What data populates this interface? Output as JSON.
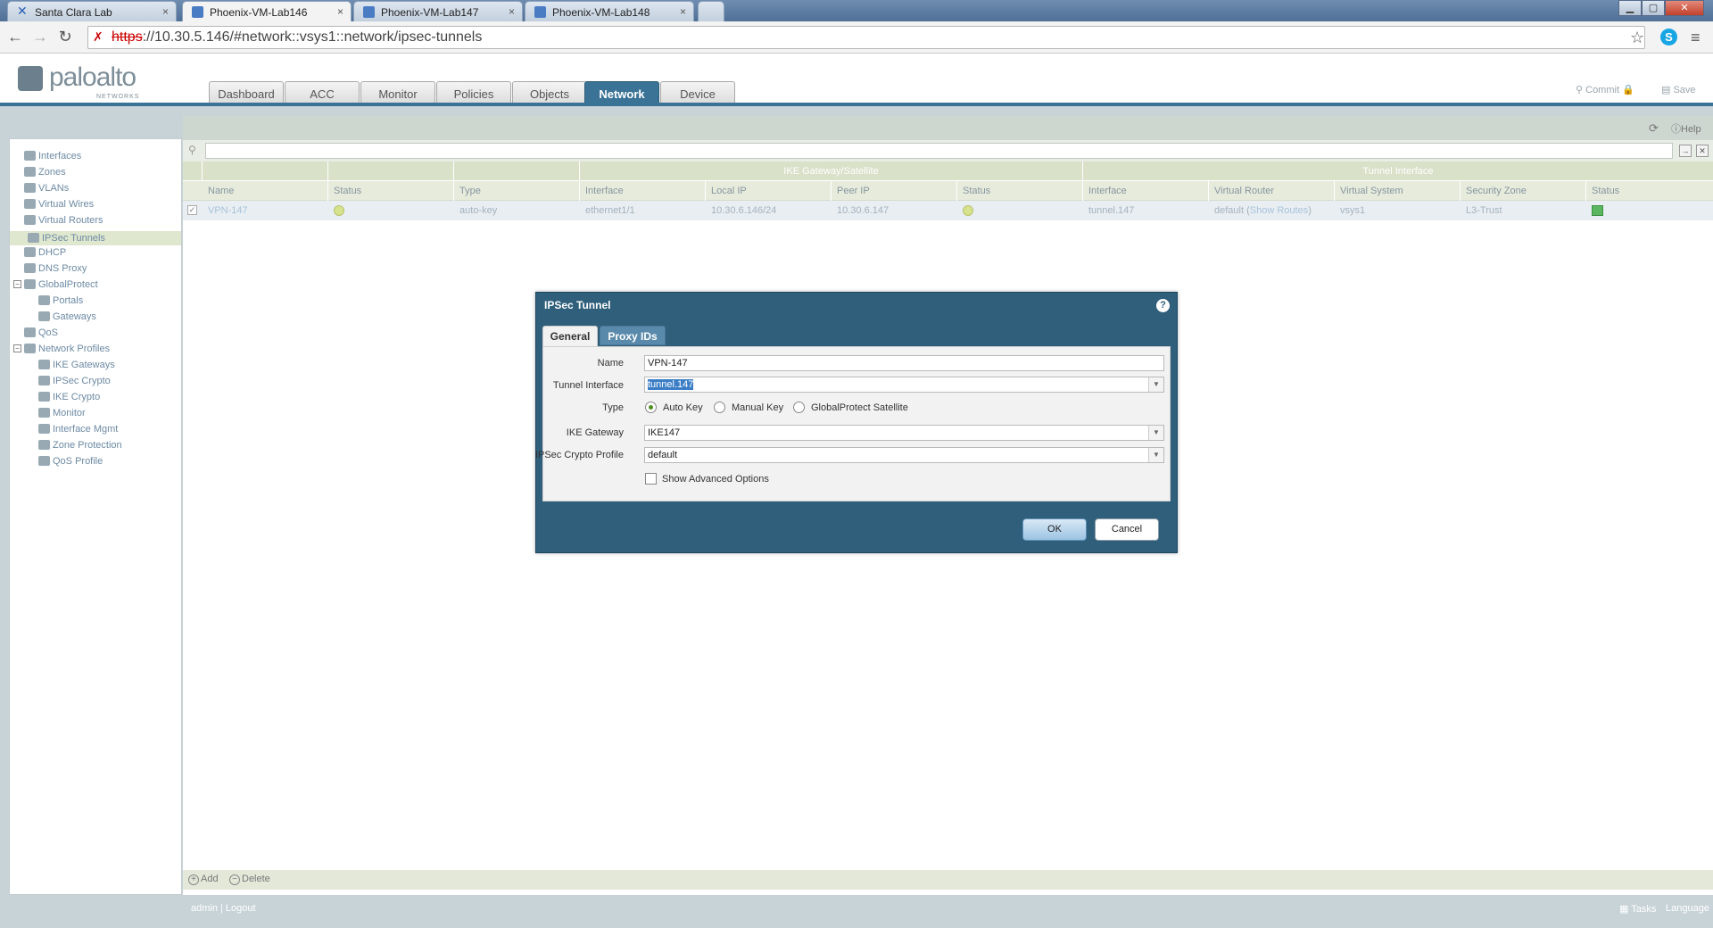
{
  "browser": {
    "tabs": [
      {
        "title": "Santa Clara Lab",
        "active": false
      },
      {
        "title": "Phoenix-VM-Lab146",
        "active": true
      },
      {
        "title": "Phoenix-VM-Lab147",
        "active": false
      },
      {
        "title": "Phoenix-VM-Lab148",
        "active": false
      }
    ],
    "close_glyph": "×",
    "url_scheme": "https",
    "url_rest": "://10.30.5.146/#network::vsys1::network/ipsec-tunnels"
  },
  "app": {
    "logo_text": "paloalto",
    "logo_sub": "NETWORKS",
    "main_tabs": [
      "Dashboard",
      "ACC",
      "Monitor",
      "Policies",
      "Objects",
      "Network",
      "Device"
    ],
    "active_tab": "Network",
    "commit_label": "Commit",
    "save_label": "Save",
    "help_label": "Help"
  },
  "sidebar": {
    "items": [
      {
        "label": "Interfaces",
        "level": 0
      },
      {
        "label": "Zones",
        "level": 0
      },
      {
        "label": "VLANs",
        "level": 0
      },
      {
        "label": "Virtual Wires",
        "level": 0
      },
      {
        "label": "Virtual Routers",
        "level": 0
      },
      {
        "label": "IPSec Tunnels",
        "level": 0,
        "selected": true
      },
      {
        "label": "DHCP",
        "level": 0
      },
      {
        "label": "DNS Proxy",
        "level": 0
      },
      {
        "label": "GlobalProtect",
        "level": 0,
        "expander": "−"
      },
      {
        "label": "Portals",
        "level": 1
      },
      {
        "label": "Gateways",
        "level": 1
      },
      {
        "label": "QoS",
        "level": 0
      },
      {
        "label": "Network Profiles",
        "level": 0,
        "expander": "−"
      },
      {
        "label": "IKE Gateways",
        "level": 1
      },
      {
        "label": "IPSec Crypto",
        "level": 1
      },
      {
        "label": "IKE Crypto",
        "level": 1
      },
      {
        "label": "Monitor",
        "level": 1
      },
      {
        "label": "Interface Mgmt",
        "level": 1
      },
      {
        "label": "Zone Protection",
        "level": 1
      },
      {
        "label": "QoS Profile",
        "level": 1
      }
    ]
  },
  "table": {
    "group_headers": {
      "ike": "IKE Gateway/Satellite",
      "tunnel": "Tunnel Interface"
    },
    "columns": [
      "Name",
      "Status",
      "Type",
      "Interface",
      "Local IP",
      "Peer IP",
      "Status",
      "Interface",
      "Virtual Router",
      "Virtual System",
      "Security Zone",
      "Status"
    ],
    "row": {
      "checked": "✓",
      "name": "VPN-147",
      "type": "auto-key",
      "interface": "ethernet1/1",
      "local_ip": "10.30.6.146/24",
      "peer_ip": "10.30.6.147",
      "tunnel_interface": "tunnel.147",
      "virtual_router_prefix": "default (",
      "virtual_router_link": "Show Routes",
      "virtual_router_suffix": ")",
      "virtual_system": "vsys1",
      "security_zone": "L3-Trust"
    },
    "add_label": "Add",
    "delete_label": "Delete"
  },
  "status_bar": {
    "user": "admin",
    "logout": "Logout",
    "tasks": "Tasks",
    "language": "Language"
  },
  "dialog": {
    "title": "IPSec Tunnel",
    "tabs": [
      "General",
      "Proxy IDs"
    ],
    "active_tab": "General",
    "fields": {
      "name_label": "Name",
      "name_value": "VPN-147",
      "tunnel_interface_label": "Tunnel Interface",
      "tunnel_interface_value": "tunnel.147",
      "type_label": "Type",
      "type_options": [
        "Auto Key",
        "Manual Key",
        "GlobalProtect Satellite"
      ],
      "type_selected": "Auto Key",
      "ike_gateway_label": "IKE Gateway",
      "ike_gateway_value": "IKE147",
      "crypto_profile_label": "IPSec Crypto Profile",
      "crypto_profile_value": "default",
      "advanced_label": "Show Advanced Options",
      "advanced_checked": false
    },
    "ok_label": "OK",
    "cancel_label": "Cancel"
  }
}
